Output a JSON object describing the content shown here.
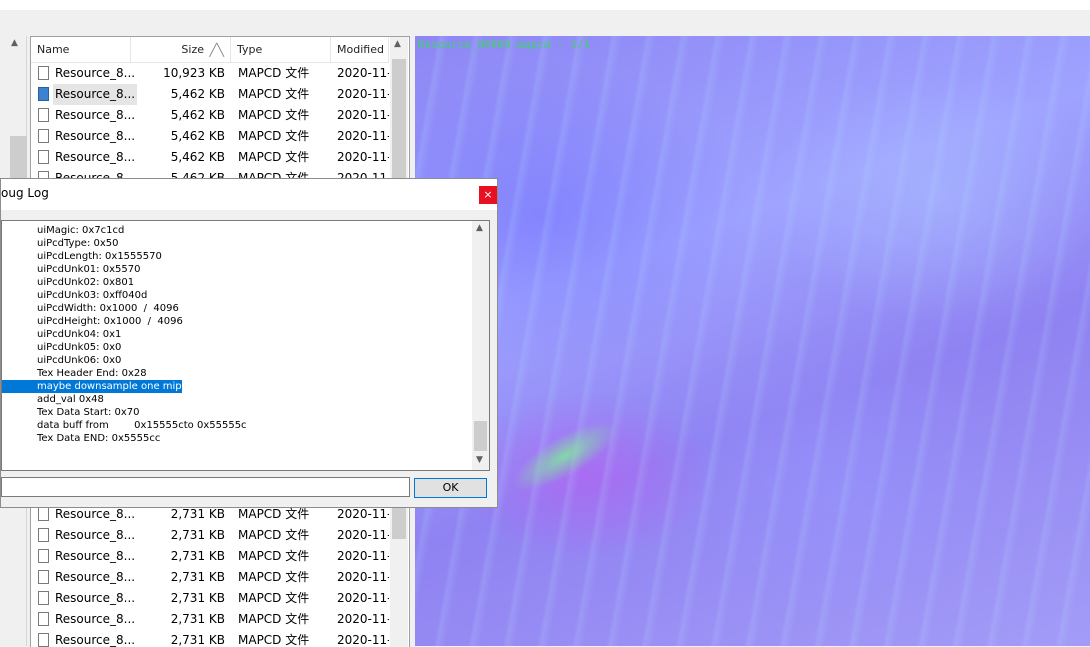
{
  "file_list": {
    "columns": {
      "name": "Name",
      "size": "Size",
      "type": "Type",
      "modified": "Modified"
    },
    "rows_top": [
      {
        "name": "Resource_8...",
        "size": "10,923 KB",
        "type": "MAPCD 文件",
        "modified": "2020-11-"
      },
      {
        "name": "Resource_8...",
        "size": "5,462 KB",
        "type": "MAPCD 文件",
        "modified": "2020-11-"
      },
      {
        "name": "Resource_8...",
        "size": "5,462 KB",
        "type": "MAPCD 文件",
        "modified": "2020-11-"
      },
      {
        "name": "Resource_8...",
        "size": "5,462 KB",
        "type": "MAPCD 文件",
        "modified": "2020-11-"
      },
      {
        "name": "Resource_8...",
        "size": "5,462 KB",
        "type": "MAPCD 文件",
        "modified": "2020-11-"
      },
      {
        "name": "Resource_8...",
        "size": "5,462 KB",
        "type": "MAPCD 文件",
        "modified": "2020-11-"
      }
    ],
    "rows_bottom": [
      {
        "name": "Resource_8...",
        "size": "2,731 KB",
        "type": "MAPCD 文件",
        "modified": "2020-11-"
      },
      {
        "name": "Resource_8...",
        "size": "2,731 KB",
        "type": "MAPCD 文件",
        "modified": "2020-11-"
      },
      {
        "name": "Resource_8...",
        "size": "2,731 KB",
        "type": "MAPCD 文件",
        "modified": "2020-11-"
      },
      {
        "name": "Resource_8...",
        "size": "2,731 KB",
        "type": "MAPCD 文件",
        "modified": "2020-11-"
      },
      {
        "name": "Resource_8...",
        "size": "2,731 KB",
        "type": "MAPCD 文件",
        "modified": "2020-11-"
      },
      {
        "name": "Resource_8...",
        "size": "2,731 KB",
        "type": "MAPCD 文件",
        "modified": "2020-11-"
      },
      {
        "name": "Resource_8...",
        "size": "2,731 KB",
        "type": "MAPCD 文件",
        "modified": "2020-11-"
      }
    ],
    "selected_index": 1
  },
  "viewer": {
    "info_text": "Resource_86869.mapcd - 1/1"
  },
  "dialog": {
    "title": "oug Log",
    "close_label": "×",
    "ok_label": "OK",
    "log_lines": [
      "uiMagic: 0x7c1cd",
      "uiPcdType: 0x50",
      "uiPcdLength: 0x1555570",
      "uiPcdUnk01: 0x5570",
      "uiPcdUnk02: 0x801",
      "uiPcdUnk03: 0xff040d",
      "uiPcdWidth: 0x1000  /  4096",
      "uiPcdHeight: 0x1000  /  4096",
      "uiPcdUnk04: 0x1",
      "uiPcdUnk05: 0x0",
      "uiPcdUnk06: 0x0",
      "Tex Header End: 0x28",
      "maybe downsample one mip",
      "add_val 0x48",
      "Tex Data Start: 0x70",
      "data buff from        0x15555cto 0x55555c",
      "Tex Data END: 0x5555cc"
    ],
    "highlighted_line": 12
  },
  "colors": {
    "selection": "#0078d7",
    "close_button": "#e81123",
    "viewer_overlay_text": "#3fd26a"
  }
}
